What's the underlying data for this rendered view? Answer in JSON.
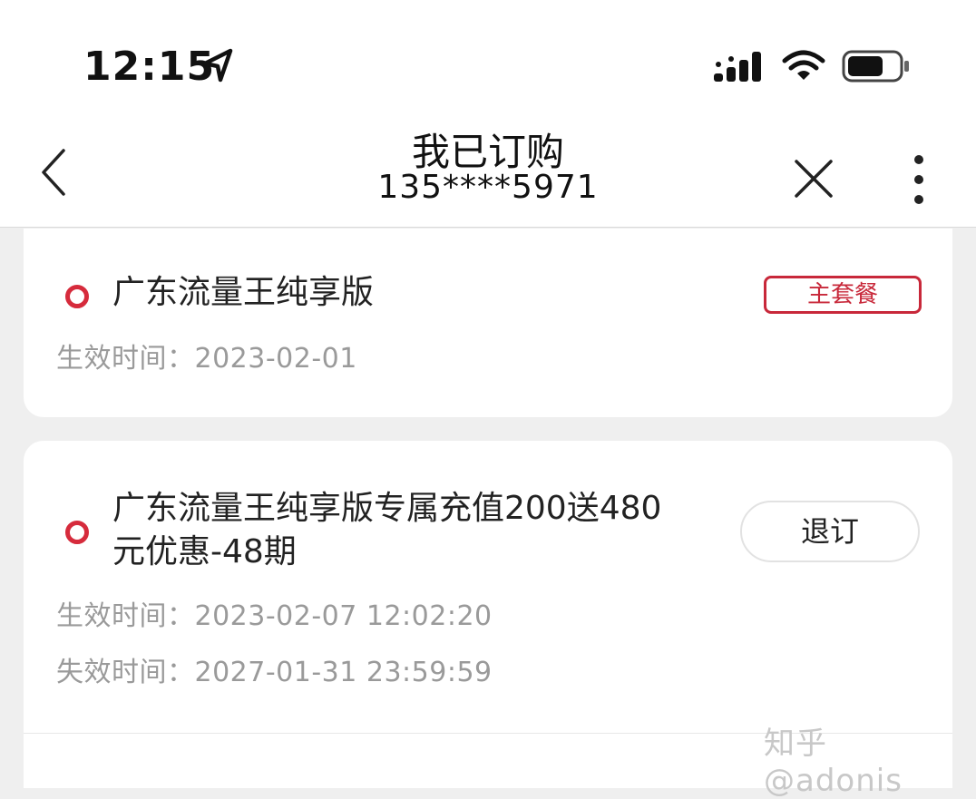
{
  "status_bar": {
    "time": "12:15",
    "icons": [
      "location-arrow-icon",
      "signal-icon",
      "wifi-icon",
      "battery-icon"
    ]
  },
  "nav": {
    "back_icon": "chevron-left-icon",
    "title": "我已订购",
    "subtitle": "135****5971",
    "close_icon": "close-icon",
    "more_icon": "more-vertical-icon"
  },
  "subscriptions": [
    {
      "name": "广东流量王纯享版",
      "badge": "主套餐",
      "effective_label": "生效时间：",
      "effective_value": "2023-02-01"
    },
    {
      "name_line1": "广东流量王纯享版专属充值200送480",
      "name_line2": "元优惠-48期",
      "action_label": "退订",
      "effective_label": "生效时间：",
      "effective_value": "2023-02-07 12:02:20",
      "expire_label": "失效时间：",
      "expire_value": "2027-01-31 23:59:59"
    }
  ],
  "watermark": "知乎 @adonis",
  "colors": {
    "accent_red": "#d62b3c",
    "muted_text": "#9a9a9a",
    "background": "#efefef"
  }
}
